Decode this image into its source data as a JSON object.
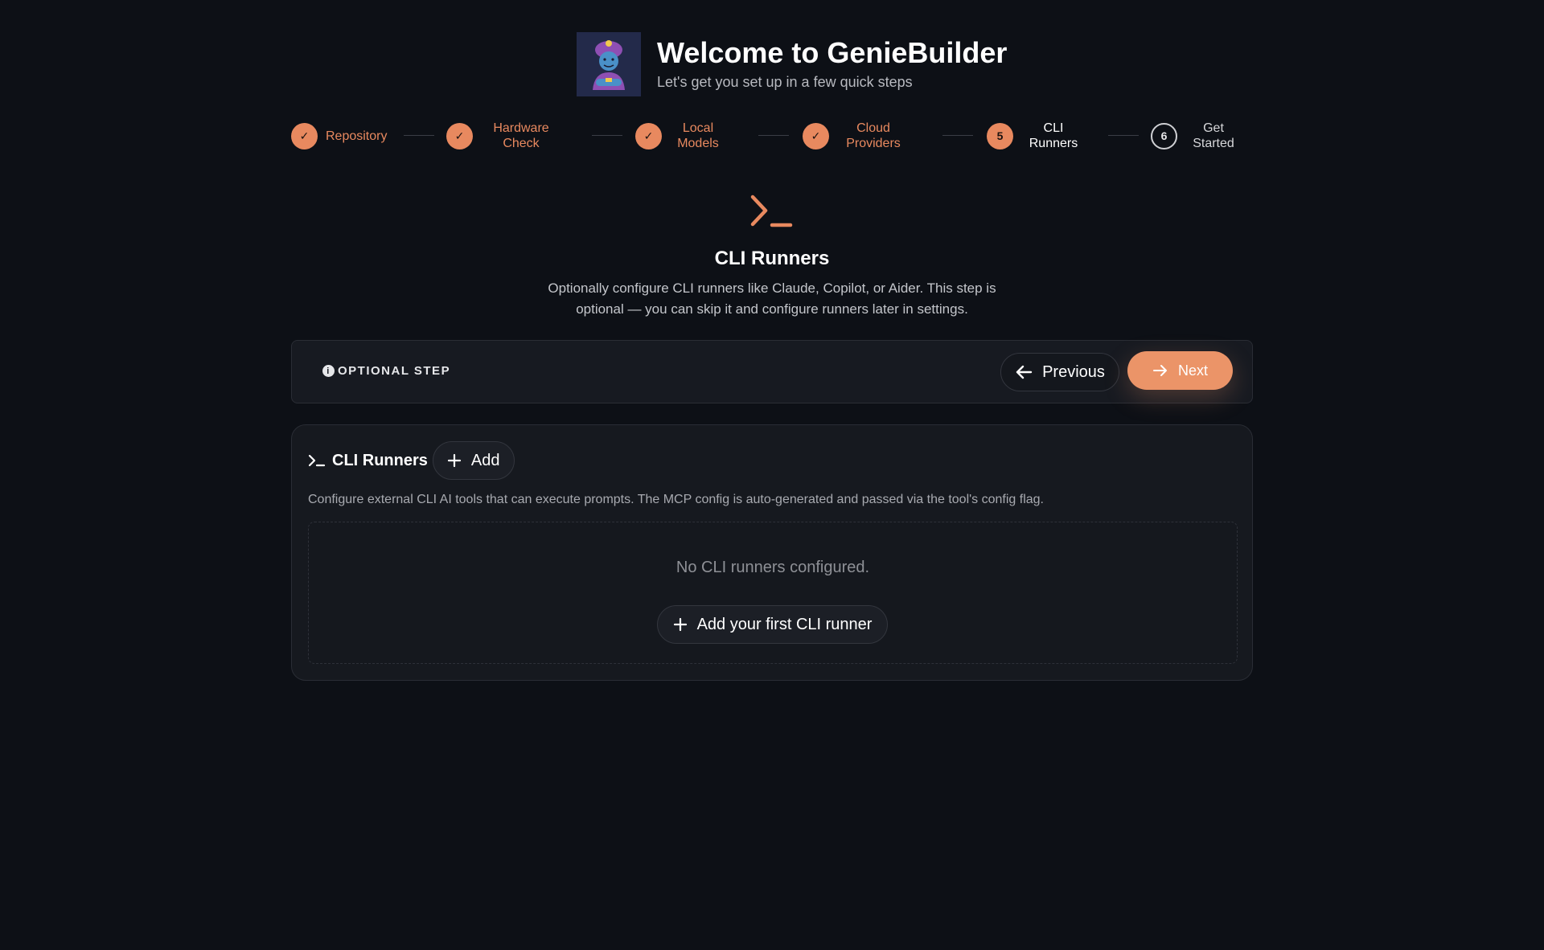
{
  "header": {
    "title": "Welcome to GenieBuilder",
    "subtitle": "Let's get you set up in a few quick steps"
  },
  "stepper": {
    "steps": [
      {
        "label": "Repository",
        "state": "done"
      },
      {
        "label": "Hardware Check",
        "state": "done"
      },
      {
        "label": "Local Models",
        "state": "done"
      },
      {
        "label": "Cloud Providers",
        "state": "done"
      },
      {
        "label": "CLI Runners",
        "number": "5",
        "state": "current"
      },
      {
        "label": "Get Started",
        "number": "6",
        "state": "future"
      }
    ],
    "check_glyph": "✓"
  },
  "step": {
    "title": "CLI Runners",
    "description": "Optionally configure CLI runners like Claude, Copilot, or Aider. This step is optional — you can skip it and configure runners later in settings."
  },
  "optional_bar": {
    "label": "OPTIONAL STEP",
    "info_glyph": "i",
    "previous_label": "Previous",
    "next_label": "Next"
  },
  "runners": {
    "title": "CLI Runners",
    "add_label": "Add",
    "description": "Configure external CLI AI tools that can execute prompts. The MCP config is auto-generated and passed via the tool's config flag.",
    "empty_text": "No CLI runners configured.",
    "add_first_label": "Add your first CLI runner"
  },
  "colors": {
    "accent": "#e8895f",
    "background": "#0d1016",
    "panel": "#16191f"
  },
  "icons": {
    "avatar": "genie-avatar-icon",
    "step_icon": "terminal-icon",
    "previous": "arrow-left-icon",
    "next": "arrow-right-icon",
    "add": "plus-icon"
  }
}
